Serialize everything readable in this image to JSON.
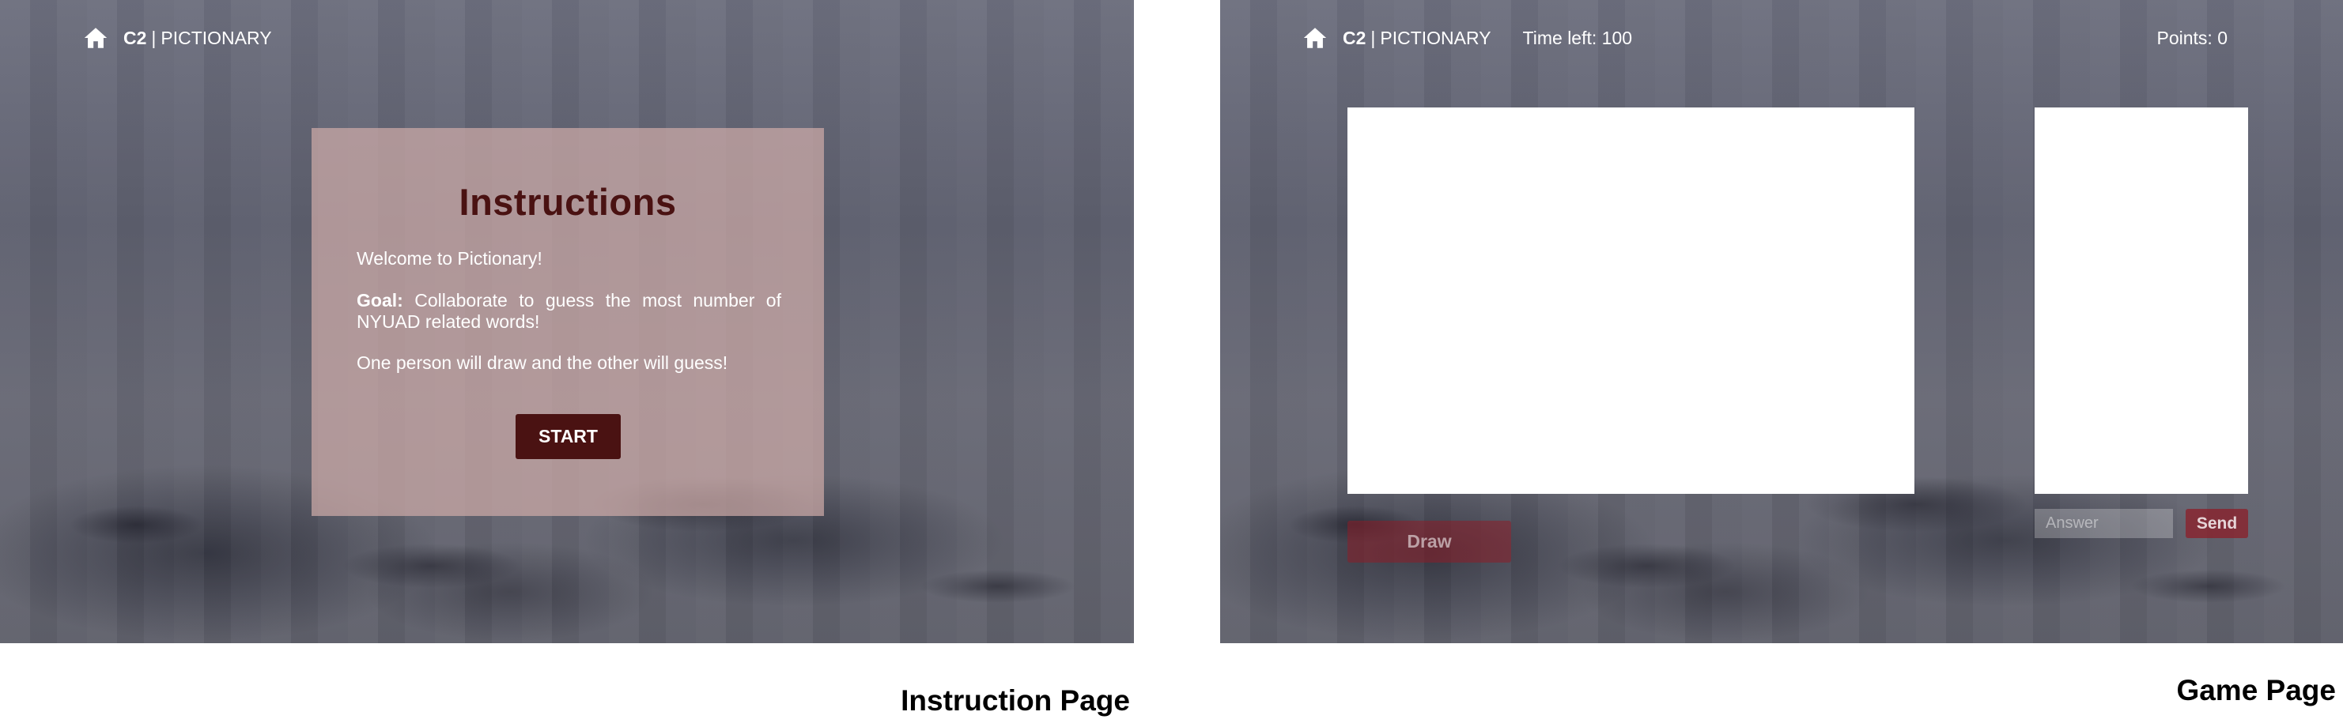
{
  "instruction_page": {
    "header": {
      "brand_strong": "C2",
      "separator": "|",
      "brand_rest": "PICTIONARY"
    },
    "panel": {
      "title": "Instructions",
      "welcome": "Welcome to Pictionary!",
      "goal_label": "Goal:",
      "goal_text": " Collaborate to guess the most number of NYUAD related words!",
      "roles": "One person will draw and the other will guess!",
      "start_label": "START"
    },
    "caption": "Instruction Page"
  },
  "game_page": {
    "header": {
      "brand_strong": "C2",
      "separator": "|",
      "brand_rest": "PICTIONARY",
      "timer": "Time left: 100",
      "points": "Points: 0"
    },
    "draw_label": "Draw",
    "answer_placeholder": "Answer",
    "send_label": "Send",
    "caption": "Game Page"
  },
  "icons": {
    "home": "home-icon"
  },
  "colors": {
    "accent": "#4a1212",
    "panel": "#cdaaa8",
    "send": "#8c1e28"
  }
}
